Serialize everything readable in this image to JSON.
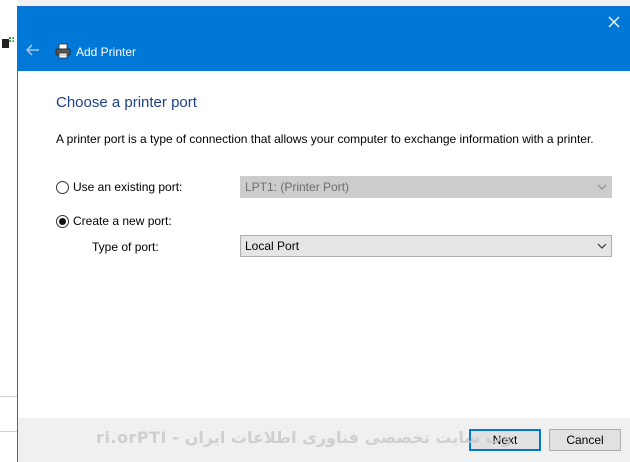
{
  "window": {
    "title": "Add Printer",
    "close_glyph": "✕"
  },
  "page": {
    "heading": "Choose a printer port",
    "description": "A printer port is a type of connection that allows your computer to exchange information with a printer."
  },
  "options": {
    "existing_port": {
      "label": "Use an existing port:",
      "value": "LPT1: (Printer Port)",
      "selected": false
    },
    "new_port": {
      "label": "Create a new port:",
      "selected": true,
      "type_label": "Type of port:",
      "type_value": "Local Port"
    }
  },
  "buttons": {
    "next": "Next",
    "cancel": "Cancel"
  },
  "watermark": {
    "text": "وب سایت تخصصی فناوری اطلاعات ایران - ITPro.ir"
  },
  "colors": {
    "titlebar": "#0078d7",
    "heading": "#1e3f8a",
    "footer": "#f0f0f0"
  },
  "icons": [
    "back-arrow-icon",
    "printer-icon",
    "close-icon",
    "chevron-down-icon",
    "radio-button"
  ]
}
